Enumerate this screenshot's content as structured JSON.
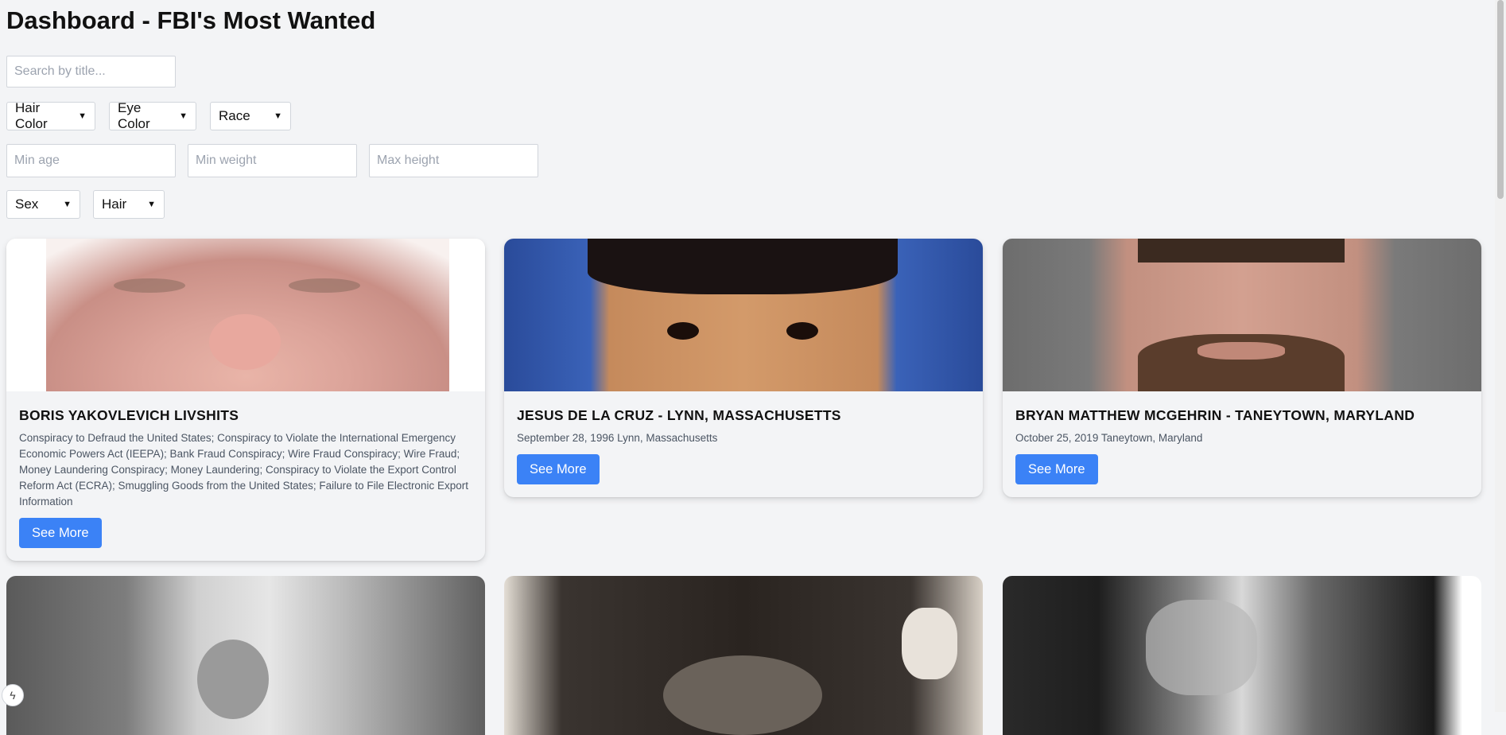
{
  "page": {
    "title": "Dashboard - FBI's Most Wanted"
  },
  "filters": {
    "search_placeholder": "Search by title...",
    "hair_color": "Hair Color",
    "eye_color": "Eye Color",
    "race": "Race",
    "min_age_placeholder": "Min age",
    "min_weight_placeholder": "Min weight",
    "max_height_placeholder": "Max height",
    "sex": "Sex",
    "hair": "Hair"
  },
  "cards": [
    {
      "title": "BORIS YAKOVLEVICH LIVSHITS",
      "description": "Conspiracy to Defraud the United States; Conspiracy to Violate the International Emergency Economic Powers Act (IEEPA); Bank Fraud Conspiracy; Wire Fraud Conspiracy; Wire Fraud; Money Laundering Conspiracy; Money Laundering; Conspiracy to Violate the Export Control Reform Act (ECRA); Smuggling Goods from the United States; Failure to File Electronic Export Information",
      "button": "See More"
    },
    {
      "title": "JESUS DE LA CRUZ - LYNN, MASSACHUSETTS",
      "description": "September 28, 1996 Lynn, Massachusetts",
      "button": "See More"
    },
    {
      "title": "BRYAN MATTHEW MCGEHRIN - TANEYTOWN, MARYLAND",
      "description": "October 25, 2019 Taneytown, Maryland",
      "button": "See More"
    }
  ],
  "colors": {
    "accent": "#3b82f6",
    "background": "#f3f4f6"
  }
}
